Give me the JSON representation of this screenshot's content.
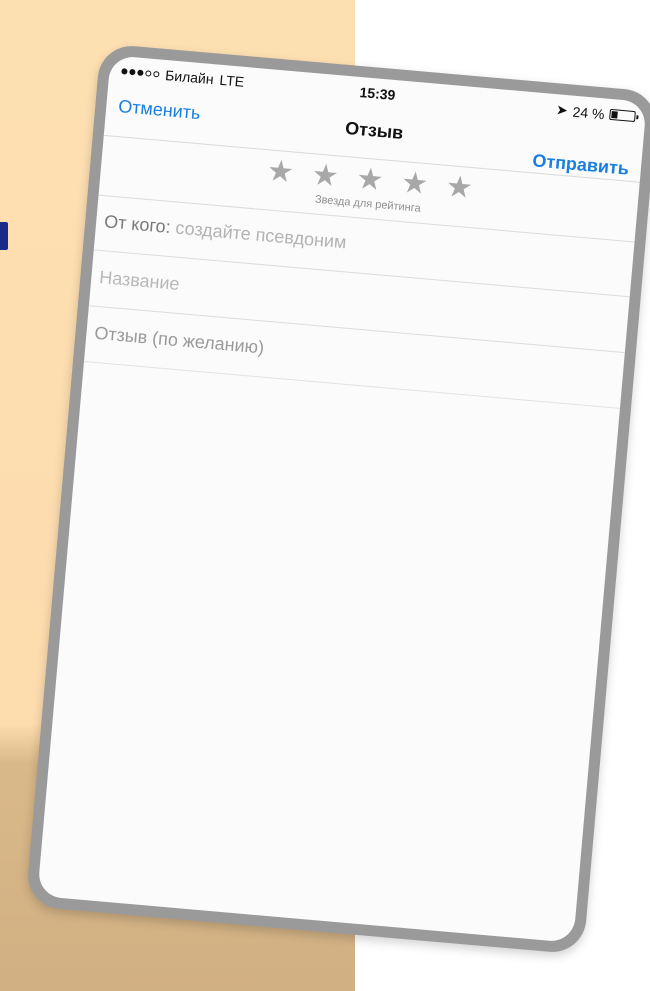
{
  "status_bar": {
    "carrier": "Билайн",
    "network": "LTE",
    "time": "15:39",
    "battery_text": "24 %",
    "battery_level": 0.24
  },
  "nav": {
    "cancel_label": "Отменить",
    "title": "Отзыв",
    "send_label": "Отправить"
  },
  "rating": {
    "stars": [
      "★",
      "★",
      "★",
      "★",
      "★"
    ],
    "hint": "Звезда для рейтинга"
  },
  "form": {
    "from_label": "От кого:",
    "from_placeholder": "создайте псевдоним",
    "title_placeholder": "Название",
    "review_placeholder": "Отзыв (по желанию)"
  },
  "colors": {
    "accent": "#1a7ee0",
    "star": "#a8a8a8",
    "backdrop": "#fde0b2"
  }
}
